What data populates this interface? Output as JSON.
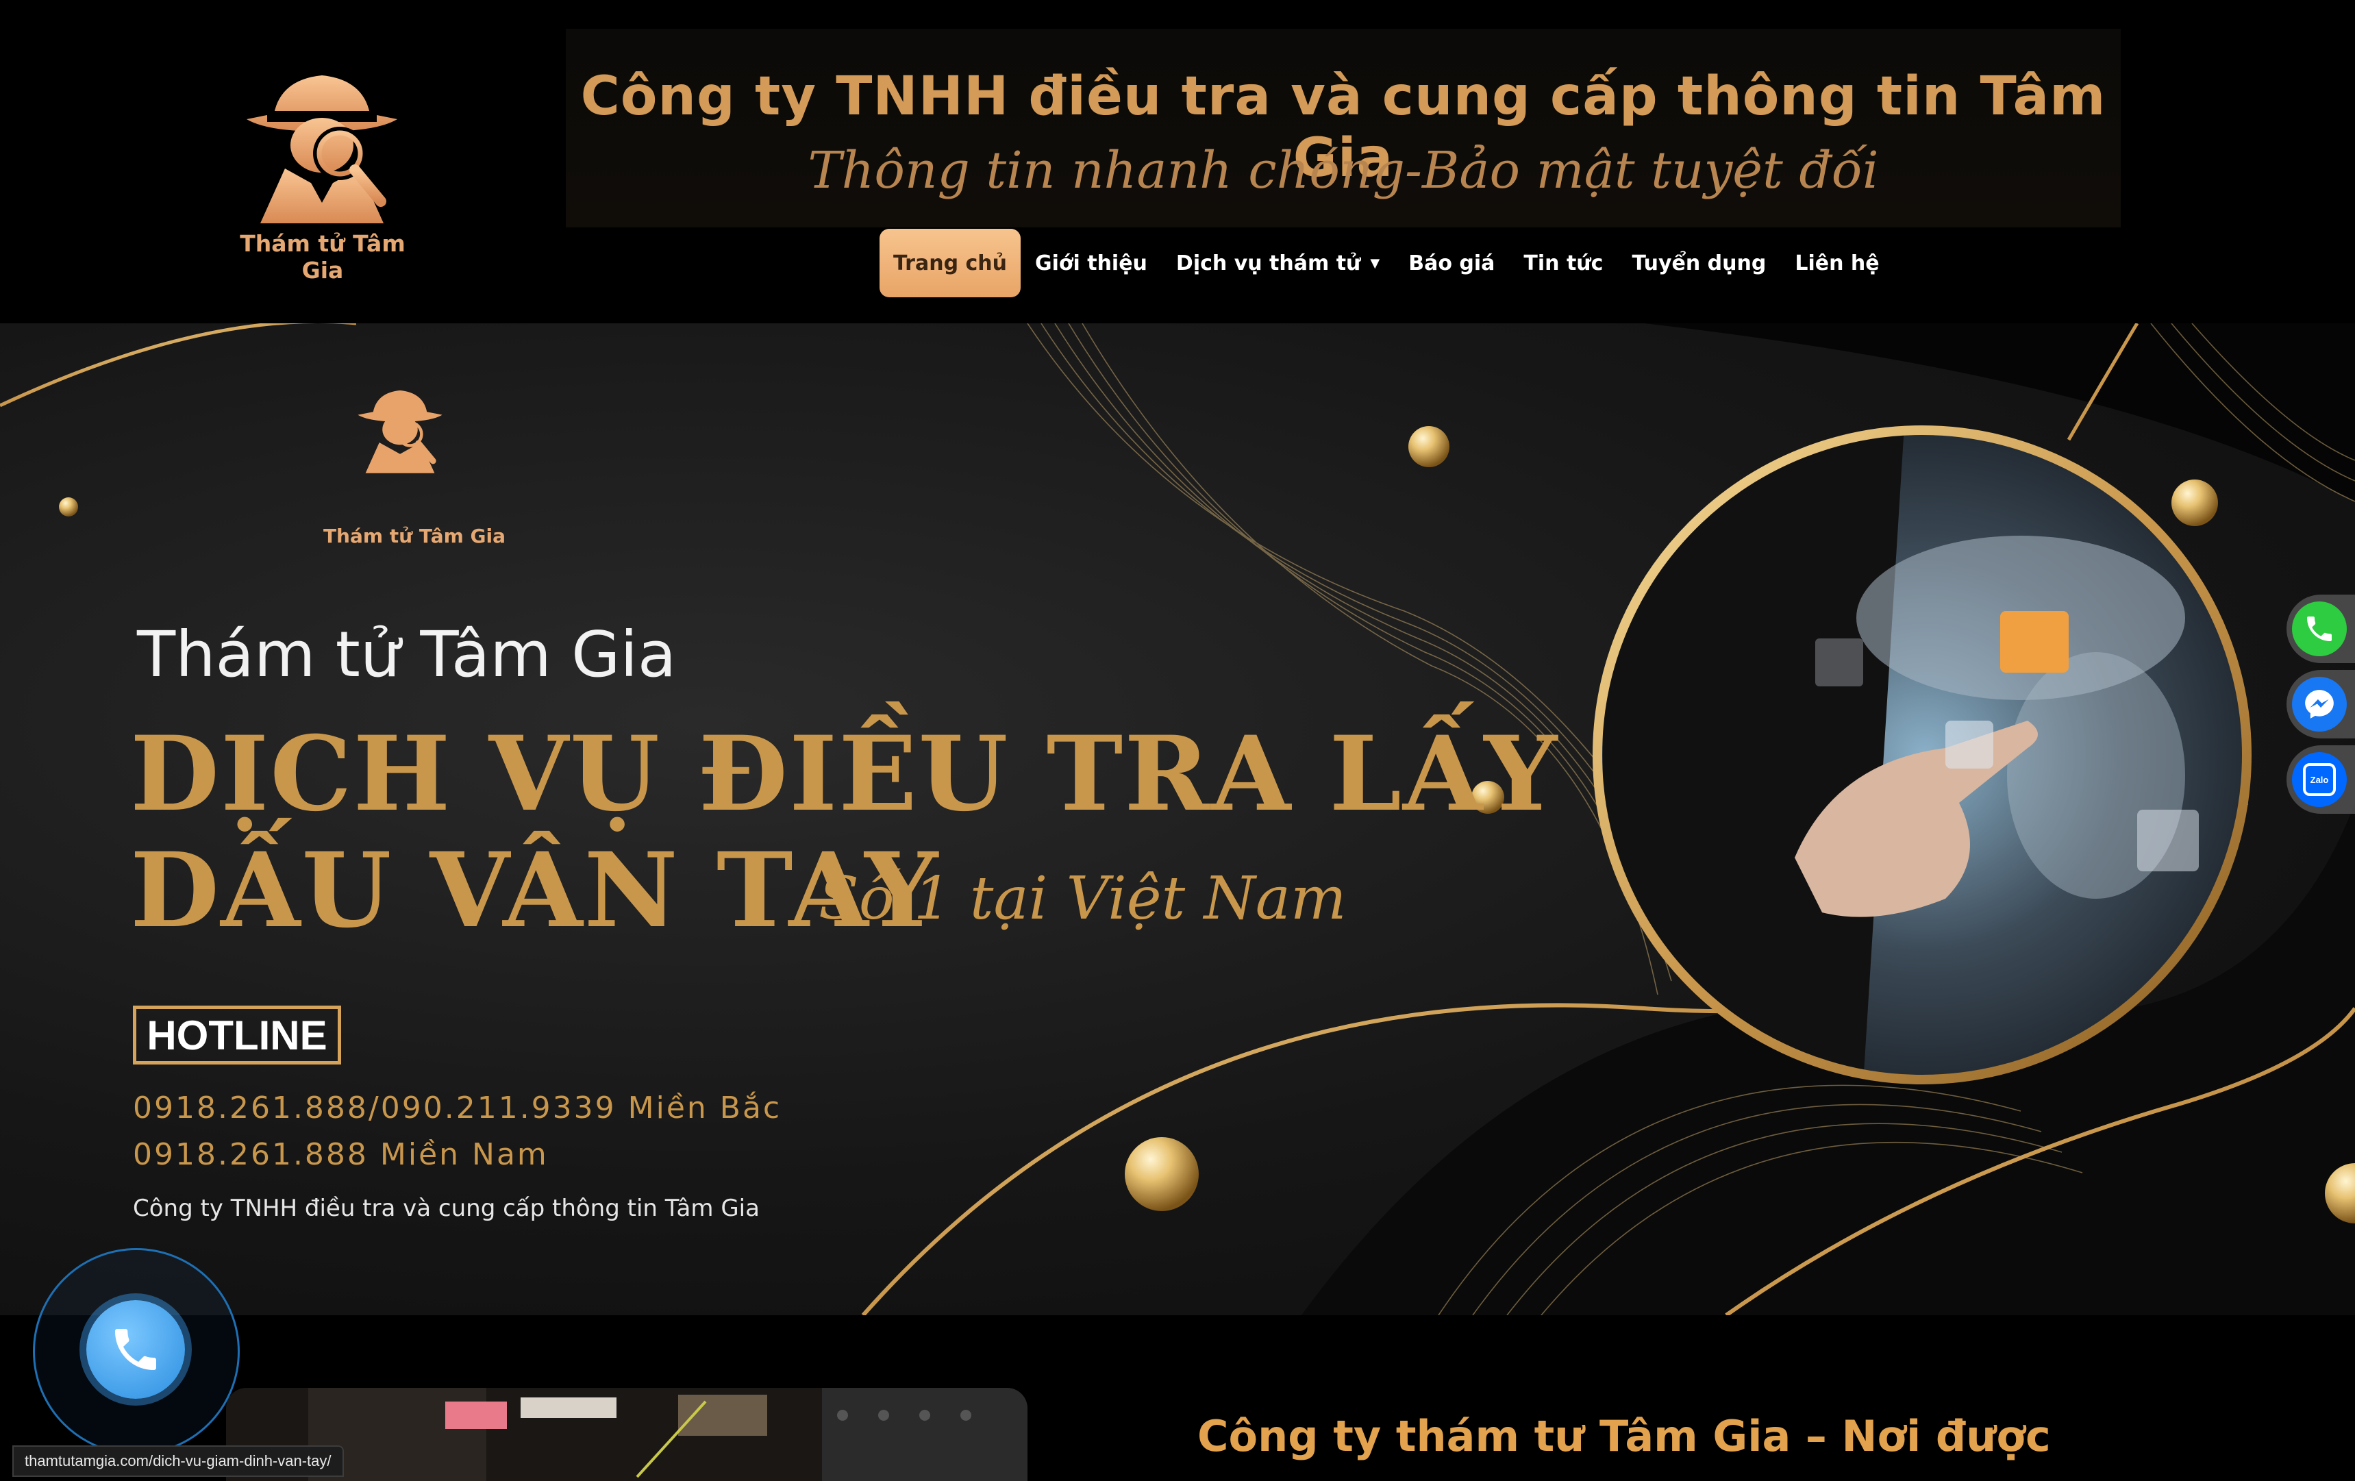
{
  "header": {
    "logo_text": "Thám tử Tâm Gia",
    "company_title": "Công ty TNHH điều tra và cung cấp thông tin Tâm Gia",
    "slogan": "Thông tin nhanh chóng-Bảo mật tuyệt đối"
  },
  "nav": {
    "items": [
      {
        "label": "Trang chủ",
        "active": true
      },
      {
        "label": "Giới thiệu"
      },
      {
        "label": "Dịch vụ thám tử",
        "has_dropdown": true
      },
      {
        "label": "Báo giá"
      },
      {
        "label": "Tin tức"
      },
      {
        "label": "Tuyển dụng"
      },
      {
        "label": "Liên hệ"
      }
    ]
  },
  "hero": {
    "logo_text": "Thám tử Tâm Gia",
    "subtitle": "Thám tử Tâm Gia",
    "title_line1": "DỊCH VỤ ĐIỀU TRA LẤY",
    "title_line2": "DẤU VÂN TAY",
    "tagline": "Số 1 tại Việt Nam",
    "hotline_label": "HOTLINE",
    "phone_north": "0918.261.888/090.211.9339 Miền Bắc",
    "phone_south": "0918.261.888 Miền Nam",
    "company": "Công ty TNHH điều tra và cung cấp thông tin Tâm Gia"
  },
  "lower": {
    "title": "Công ty thám tư Tâm Gia – Nơi được"
  },
  "floating": {
    "buttons": [
      "phone-icon",
      "messenger-icon",
      "zalo-icon"
    ],
    "zalo_text": "Zalo"
  },
  "status_bar": {
    "url": "thamtutamgia.com/dich-vu-giam-dinh-van-tay/"
  },
  "colors": {
    "gold": "#c9974c",
    "nav_active": "#f7c48e",
    "phone_green": "#2ecc40",
    "messenger_blue": "#1877f2",
    "zalo_blue": "#0068ff",
    "call_blue": "#2b8ee0"
  }
}
